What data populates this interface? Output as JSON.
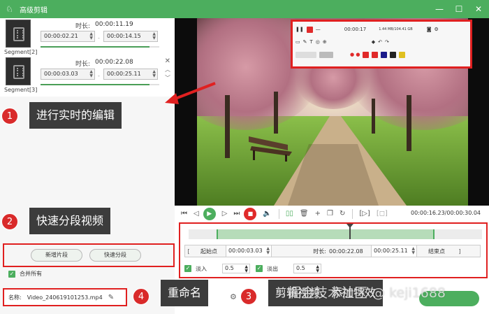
{
  "app": {
    "title": "高级剪辑",
    "logo_icon": "rabbit-logo-icon"
  },
  "window_controls": {
    "minimize": "—",
    "maximize": "☐",
    "close": "✕"
  },
  "segments": [
    {
      "label": "Segment[2]",
      "duration_label": "时长:",
      "duration": "00:00:11.19",
      "start": "00:00:02.21",
      "end": "00:00:14.15",
      "progress": 0.92
    },
    {
      "label": "Segment[3]",
      "duration_label": "时长:",
      "duration": "00:00:22.08",
      "start": "00:00:03.03",
      "end": "00:00:25.11",
      "progress": 0.92
    }
  ],
  "overlay": {
    "time": "00:00:17",
    "size": "1.44 MB/104.41 GB"
  },
  "playback": {
    "time": "00:00:16.23/00:00:30.04"
  },
  "trim": {
    "start_label": "起始点",
    "start_value": "00:00:03.03",
    "duration_label": "时长:",
    "duration_value": "00:00:22.08",
    "end_value": "00:00:25.11",
    "end_label": "结束点"
  },
  "fade": {
    "in_label": "淡入",
    "in_value": "0.5",
    "out_label": "淡出",
    "out_value": "0.5"
  },
  "buttons": {
    "new_segment": "新增片段",
    "quick_split": "快速分段"
  },
  "merge": {
    "label": "合并所有",
    "checked": true
  },
  "filename": {
    "label": "名称:",
    "value": "Video_240619101253.mp4"
  },
  "annotations": [
    {
      "num": "1",
      "text": "进行实时的编辑"
    },
    {
      "num": "2",
      "text": "快速分段视频"
    },
    {
      "num": "3",
      "text": "剪辑视频、添加特效"
    },
    {
      "num": "4",
      "text": "重命名"
    }
  ],
  "watermark": "掘金技术社区 @ keji1688",
  "colors": {
    "accent": "#4cae5e",
    "highlight": "#e02020",
    "callout": "#3c3c3c"
  }
}
